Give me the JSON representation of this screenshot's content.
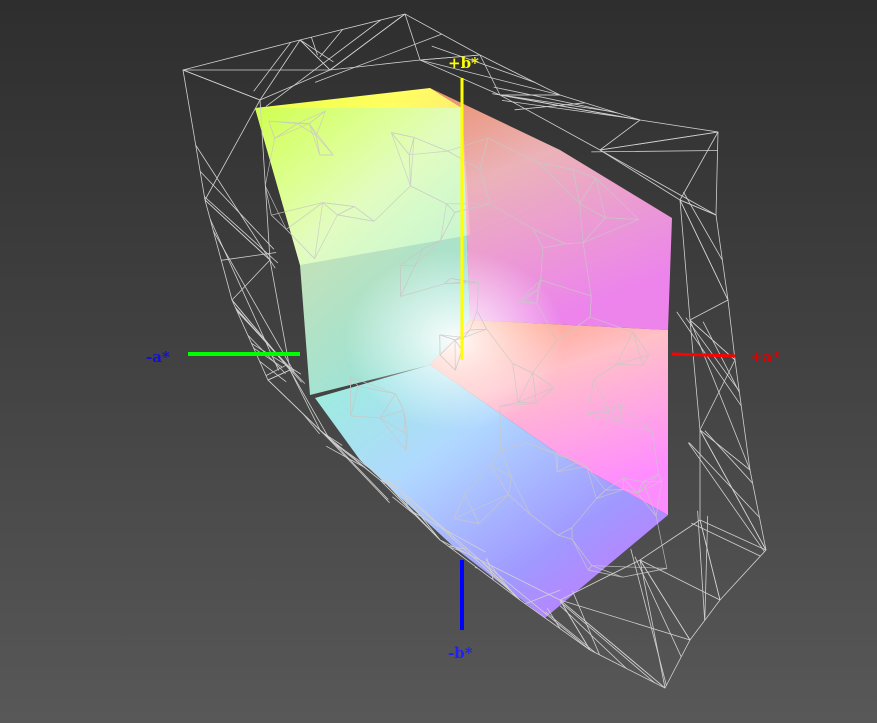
{
  "axes": {
    "plus_b": {
      "label": "+b*",
      "color": "#ffff00"
    },
    "minus_b": {
      "label": "-b*",
      "color": "#0000ff"
    },
    "plus_a": {
      "label": "+a*",
      "color": "#ff0000"
    },
    "minus_a": {
      "label": "-a*",
      "color": "#00ff00"
    },
    "minus_a_label_color": "#0000cc"
  },
  "colors": {
    "background_top": "#2e2e2e",
    "background_bottom": "#585858",
    "wireframe": "#d0d0d0",
    "mesh": "#c8c8c8"
  }
}
